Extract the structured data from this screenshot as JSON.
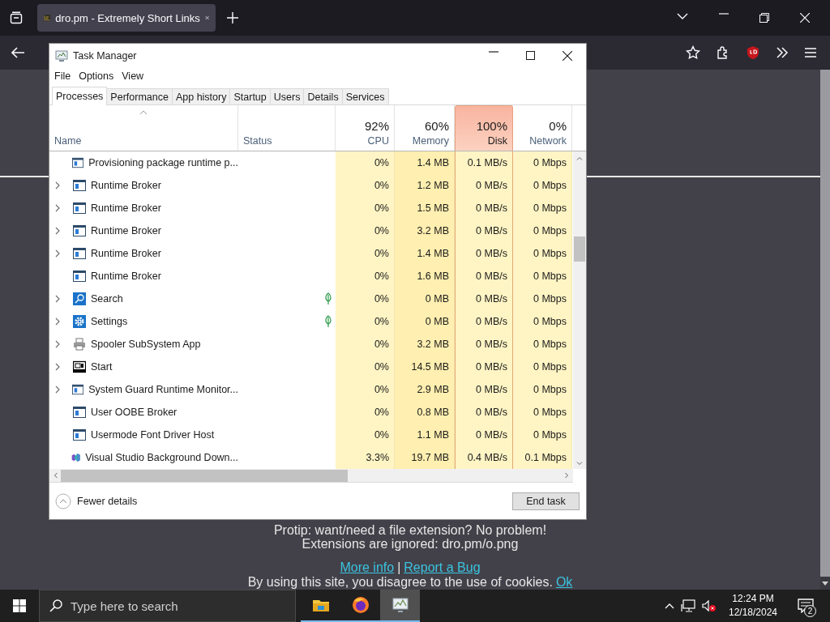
{
  "browser": {
    "tab": {
      "title": "dro.pm - Extremely Short Links",
      "selected": true
    },
    "page": {
      "lines": [
        "Protip: want/need a file extension? No problem!",
        "Extensions are ignored: dro.pm/o.png"
      ],
      "links": [
        "More info",
        "Report a Bug"
      ],
      "link_separator": "|",
      "cookie_notice": {
        "text": "By using this site, you disagree to the use of cookies.",
        "link": "Ok"
      }
    }
  },
  "task_manager": {
    "title": "Task Manager",
    "menu": [
      "File",
      "Options",
      "View"
    ],
    "tabs": [
      {
        "label": "Processes",
        "selected": true
      },
      {
        "label": "Performance",
        "selected": false
      },
      {
        "label": "App history",
        "selected": false
      },
      {
        "label": "Startup",
        "selected": false
      },
      {
        "label": "Users",
        "selected": false
      },
      {
        "label": "Details",
        "selected": false
      },
      {
        "label": "Services",
        "selected": false
      }
    ],
    "columns": [
      {
        "label": "Name"
      },
      {
        "label": "Status"
      },
      {
        "label": "CPU",
        "usage": "92%",
        "highlighted": false
      },
      {
        "label": "Memory",
        "usage": "60%",
        "highlighted": false
      },
      {
        "label": "Disk",
        "usage": "100%",
        "highlighted": true
      },
      {
        "label": "Network",
        "usage": "0%",
        "highlighted": false
      }
    ],
    "rows": [
      {
        "name": "Provisioning package runtime p...",
        "kind": "app",
        "expandable": false,
        "suspended": false,
        "cpu": "0%",
        "memory": "1.4 MB",
        "disk": "0.1 MB/s",
        "network": "0 Mbps"
      },
      {
        "name": "Runtime Broker",
        "kind": "app",
        "expandable": true,
        "suspended": false,
        "cpu": "0%",
        "memory": "1.2 MB",
        "disk": "0 MB/s",
        "network": "0 Mbps"
      },
      {
        "name": "Runtime Broker",
        "kind": "app",
        "expandable": true,
        "suspended": false,
        "cpu": "0%",
        "memory": "1.5 MB",
        "disk": "0 MB/s",
        "network": "0 Mbps"
      },
      {
        "name": "Runtime Broker",
        "kind": "app",
        "expandable": true,
        "suspended": false,
        "cpu": "0%",
        "memory": "3.2 MB",
        "disk": "0 MB/s",
        "network": "0 Mbps"
      },
      {
        "name": "Runtime Broker",
        "kind": "app",
        "expandable": true,
        "suspended": false,
        "cpu": "0%",
        "memory": "1.4 MB",
        "disk": "0 MB/s",
        "network": "0 Mbps"
      },
      {
        "name": "Runtime Broker",
        "kind": "app",
        "expandable": false,
        "suspended": false,
        "cpu": "0%",
        "memory": "1.6 MB",
        "disk": "0 MB/s",
        "network": "0 Mbps"
      },
      {
        "name": "Search",
        "kind": "search",
        "expandable": true,
        "suspended": true,
        "cpu": "0%",
        "memory": "0 MB",
        "disk": "0 MB/s",
        "network": "0 Mbps"
      },
      {
        "name": "Settings",
        "kind": "settings",
        "expandable": true,
        "suspended": true,
        "cpu": "0%",
        "memory": "0 MB",
        "disk": "0 MB/s",
        "network": "0 Mbps"
      },
      {
        "name": "Spooler SubSystem App",
        "kind": "printer",
        "expandable": true,
        "suspended": false,
        "cpu": "0%",
        "memory": "3.2 MB",
        "disk": "0 MB/s",
        "network": "0 Mbps"
      },
      {
        "name": "Start",
        "kind": "start",
        "expandable": true,
        "suspended": false,
        "cpu": "0%",
        "memory": "14.5 MB",
        "disk": "0 MB/s",
        "network": "0 Mbps"
      },
      {
        "name": "System Guard Runtime Monitor...",
        "kind": "app",
        "expandable": true,
        "suspended": false,
        "cpu": "0%",
        "memory": "2.9 MB",
        "disk": "0 MB/s",
        "network": "0 Mbps"
      },
      {
        "name": "User OOBE Broker",
        "kind": "app",
        "expandable": false,
        "suspended": false,
        "cpu": "0%",
        "memory": "0.8 MB",
        "disk": "0 MB/s",
        "network": "0 Mbps"
      },
      {
        "name": "Usermode Font Driver Host",
        "kind": "app",
        "expandable": false,
        "suspended": false,
        "cpu": "0%",
        "memory": "1.1 MB",
        "disk": "0 MB/s",
        "network": "0 Mbps"
      },
      {
        "name": "Visual Studio Background Down...",
        "kind": "studio",
        "expandable": false,
        "suspended": false,
        "cpu": "3.3%",
        "memory": "19.7 MB",
        "disk": "0.4 MB/s",
        "network": "0.1 Mbps"
      }
    ],
    "footer": {
      "toggle": "Fewer details",
      "button": "End task"
    }
  },
  "taskbar": {
    "search": {
      "placeholder": "Type here to search"
    },
    "apps": [
      {
        "kind": "explorer",
        "active": false
      },
      {
        "kind": "firefox",
        "active": false
      },
      {
        "kind": "task-manager",
        "active": true
      }
    ],
    "time": "12:24 PM",
    "date": "12/18/2024",
    "notifications": "2"
  }
}
